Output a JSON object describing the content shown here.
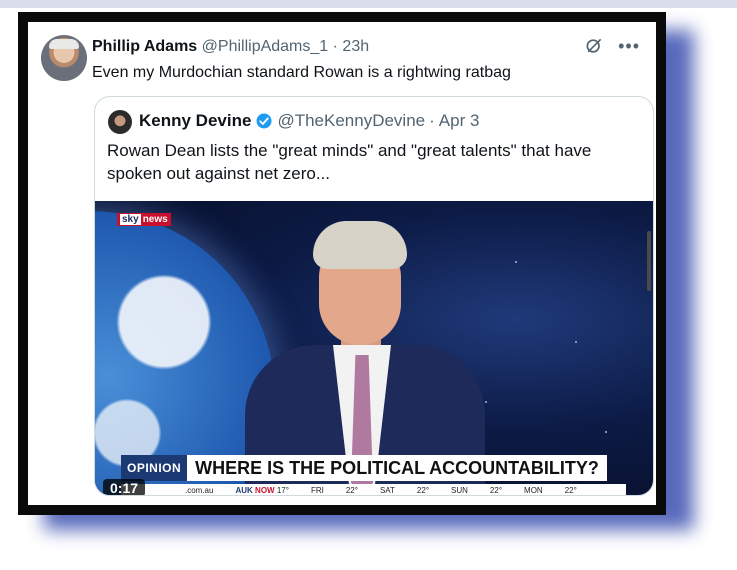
{
  "post": {
    "author_name": "Phillip Adams",
    "author_handle": "@PhillipAdams_1",
    "time": "23h",
    "separator": "·",
    "text": "Even my Murdochian standard Rowan is a rightwing ratbag",
    "icons": [
      "grok-icon",
      "more-icon"
    ]
  },
  "quote": {
    "author_name": "Kenny Devine",
    "author_handle": "@TheKennyDevine",
    "date": "Apr 3",
    "separator": "·",
    "text": "Rowan Dean lists the \"great minds\" and \"great talents\" that have spoken out against net zero...",
    "verified_color": "#1d9bf0"
  },
  "video": {
    "channel_logo_part1": "sky",
    "channel_logo_part2": "news",
    "opinion_label": "OPINION",
    "headline": "WHERE IS THE POLITICAL ACCOUNTABILITY?",
    "timestamp": "0:17",
    "ticker": {
      "site": ".com.au",
      "city": "AUK",
      "now": "NOW",
      "now_temp": "17°",
      "days": [
        {
          "label": "FRI",
          "temp": "22°"
        },
        {
          "label": "SAT",
          "temp": "22°"
        },
        {
          "label": "SUN",
          "temp": "22°"
        },
        {
          "label": "MON",
          "temp": "22°"
        }
      ]
    }
  }
}
